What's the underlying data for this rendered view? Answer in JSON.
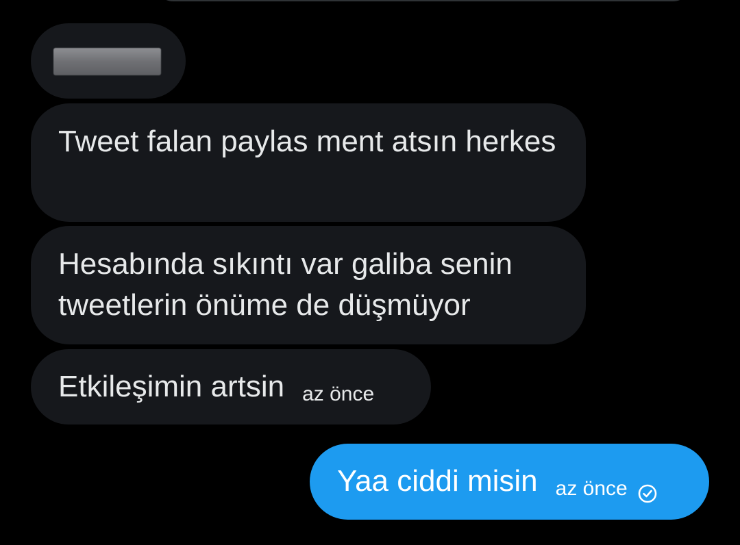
{
  "conversation": {
    "messages": [
      {
        "direction": "incoming",
        "content": "redacted"
      },
      {
        "direction": "incoming",
        "text": "Tweet falan paylas ment atsın herkes"
      },
      {
        "direction": "incoming",
        "text": "Hesabında sıkıntı var galiba senin tweetlerin önüme de düşmüyor"
      },
      {
        "direction": "incoming",
        "text": "Etkileşimin artsin",
        "time": "az önce"
      },
      {
        "direction": "outgoing",
        "text": "Yaa ciddi misin",
        "time": "az önce",
        "status_icon": "read-check-circle-icon"
      }
    ]
  },
  "colors": {
    "background": "#000000",
    "incoming_bubble": "#16181c",
    "outgoing_bubble": "#1d9bf0",
    "incoming_text": "#e7e9ea",
    "outgoing_text": "#ffffff"
  }
}
